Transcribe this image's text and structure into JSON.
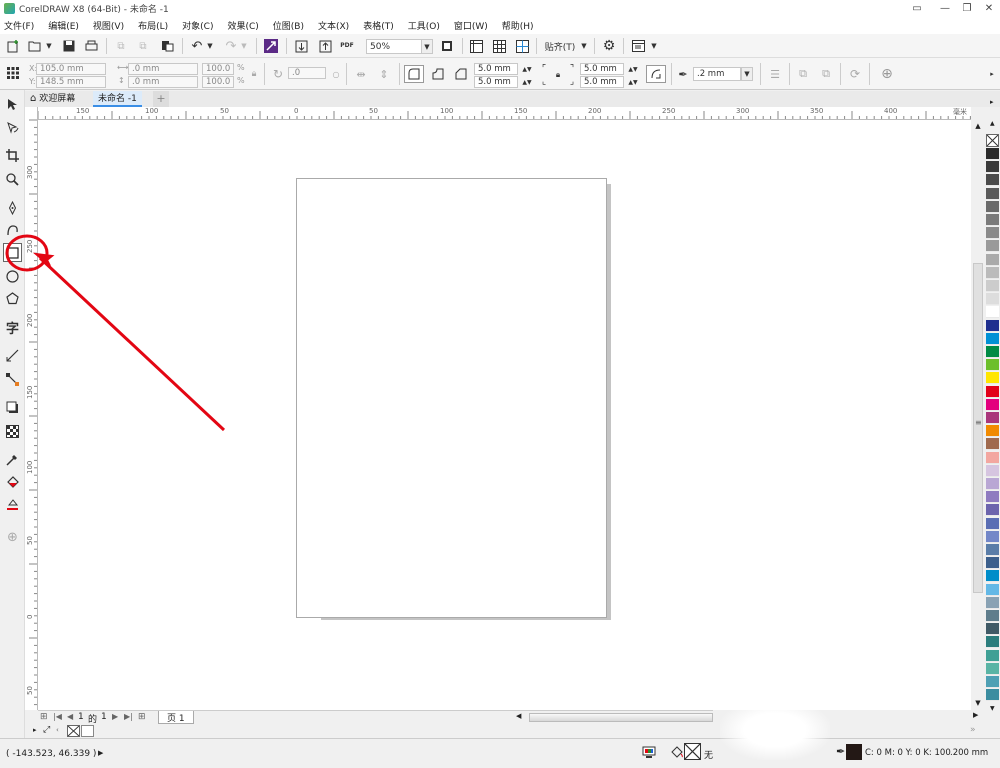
{
  "window": {
    "title": "CorelDRAW X8 (64-Bit) - 未命名 -1",
    "controls": [
      "▭",
      "—",
      "❐",
      "✕"
    ]
  },
  "menu": [
    "文件(F)",
    "编辑(E)",
    "视图(V)",
    "布局(L)",
    "对象(C)",
    "效果(C)",
    "位图(B)",
    "文本(X)",
    "表格(T)",
    "工具(O)",
    "窗口(W)",
    "帮助(H)"
  ],
  "standard_toolbar": {
    "zoom_value": "50%",
    "snap_label": "贴齐(T)",
    "pdf_label": "PDF"
  },
  "property_bar": {
    "x": "105.0 mm",
    "y": "148.5 mm",
    "width": ".0 mm",
    "height": ".0 mm",
    "scale_x": "100.0",
    "scale_y": "100.0",
    "percent": "%",
    "angle": ".0",
    "corner_tl": "5.0 mm",
    "corner_bl": "5.0 mm",
    "corner_tr": "5.0 mm",
    "corner_br": "5.0 mm",
    "outline_width": ".2 mm"
  },
  "tabs": {
    "welcome": "欢迎屏幕",
    "document": "未命名 -1",
    "add": "+"
  },
  "ruler": {
    "h_labels": [
      "150",
      "100",
      "50",
      "0",
      "50",
      "100",
      "150",
      "200",
      "250",
      "300",
      "350",
      "400"
    ],
    "h_unit": "毫米",
    "v_labels": [
      "300",
      "250",
      "200",
      "150",
      "100",
      "50",
      "0",
      "50"
    ]
  },
  "page_nav": {
    "current": "1",
    "of_label": "的",
    "total": "1",
    "page_tab": "页 1"
  },
  "status": {
    "coords": "( -143.523, 46.339 )",
    "fill_none": "无",
    "outline_info": "C: 0 M: 0 Y: 0 K: 100",
    "outline_width": ".200 mm"
  },
  "palette_colors": [
    "#2b2b2b",
    "#3a3a3a",
    "#4a4a4a",
    "#5a5a5a",
    "#6a6a6a",
    "#7a7a7a",
    "#8a8a8a",
    "#9a9a9a",
    "#aaaaaa",
    "#bbbbbb",
    "#cccccc",
    "#dddddd",
    "#ffffff",
    "#1f2f8f",
    "#0091d5",
    "#008b45",
    "#6cbf2b",
    "#ffe600",
    "#e2001a",
    "#e3007e",
    "#a9367b",
    "#f18a00",
    "#a06a4e",
    "#f3a7a0",
    "#d6c5e0",
    "#b9a7d4",
    "#8f7bc0",
    "#6c64ad",
    "#5a6eb4",
    "#7387c8",
    "#5a7da8",
    "#3c5f8c",
    "#008dc9",
    "#63b8e6",
    "#89a2b4",
    "#5f7d8c",
    "#405a66",
    "#2b7d7d",
    "#3fa095",
    "#5ab4a5",
    "#4fa0b4",
    "#3b8da0"
  ],
  "colors": {
    "accent_red": "#e30613",
    "canvas_bg": "#ffffff",
    "chrome_bg": "#f0f0f0"
  }
}
